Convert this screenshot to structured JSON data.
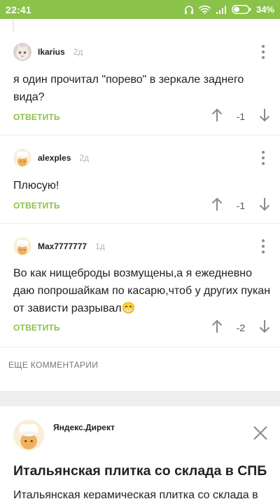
{
  "status_bar": {
    "time": "22:41",
    "battery": "34%",
    "color": "#8ac24a"
  },
  "comments": [
    {
      "username": "Ikarius",
      "time": "2д",
      "text": "я один прочитал \"порево\" в зеркале заднего вида?",
      "reply_label": "ОТВЕТИТЬ",
      "score": "-1",
      "avatar_icon": "cat-avatar-icon"
    },
    {
      "username": "alexples",
      "time": "2д",
      "text": "Плюсую!",
      "reply_label": "ОТВЕТИТЬ",
      "score": "-1",
      "avatar_icon": "chef-avatar-icon"
    },
    {
      "username": "Max7777777",
      "time": "1д",
      "text": "Во как нищеброды возмущены,а я ежедневно даю попрошайкам по касарю,чтоб у других пукан от зависти разрывал😁",
      "reply_label": "ОТВЕТИТЬ",
      "score": "-2",
      "avatar_icon": "chef-avatar-icon"
    }
  ],
  "more_comments_label": "ЕЩЕ КОММЕНТАРИИ",
  "ad": {
    "source": "Яндекс.Директ",
    "title": "Итальянская плитка со склада в СПБ",
    "description": "Итальянская керамическая плитка со склада в",
    "close_icon": "close-icon"
  },
  "colors": {
    "accent": "#8ac24a",
    "icon_gray": "#8a8a8a",
    "muted": "#b5b5b5"
  }
}
